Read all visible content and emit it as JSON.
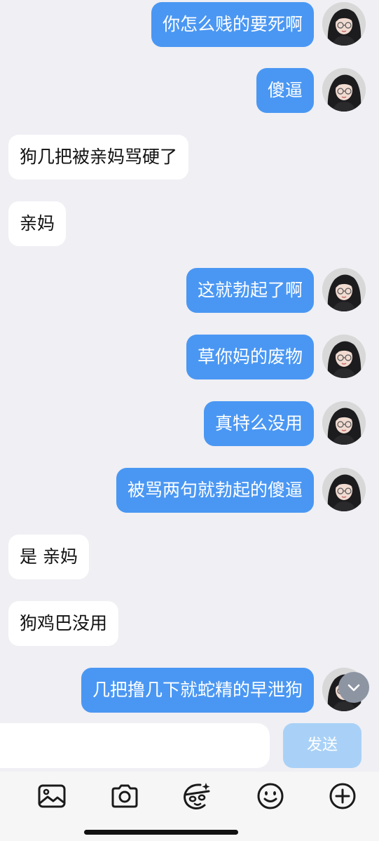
{
  "messages": [
    {
      "side": "out",
      "text": "你怎么贱的要死啊"
    },
    {
      "side": "out",
      "text": "傻逼"
    },
    {
      "side": "in",
      "text": "狗几把被亲妈骂硬了"
    },
    {
      "side": "in",
      "text": "亲妈"
    },
    {
      "side": "out",
      "text": "这就勃起了啊"
    },
    {
      "side": "out",
      "text": "草你妈的废物"
    },
    {
      "side": "out",
      "text": "真特么没用"
    },
    {
      "side": "out",
      "text": "被骂两句就勃起的傻逼"
    },
    {
      "side": "in",
      "text": "是 亲妈"
    },
    {
      "side": "in",
      "text": "狗鸡巴没用"
    },
    {
      "side": "out",
      "text": "几把撸几下就蛇精的早泄狗"
    }
  ],
  "composer": {
    "input_value": "",
    "send_label": "发送"
  },
  "toolbar": {
    "icons": [
      "image-icon",
      "camera-icon",
      "sticker-icon",
      "emoji-icon",
      "plus-circle-icon"
    ]
  },
  "colors": {
    "outgoing_bubble": "#4a97f3",
    "incoming_bubble": "#ffffff",
    "background": "#efeff4",
    "send_button": "#a9d1f7"
  }
}
